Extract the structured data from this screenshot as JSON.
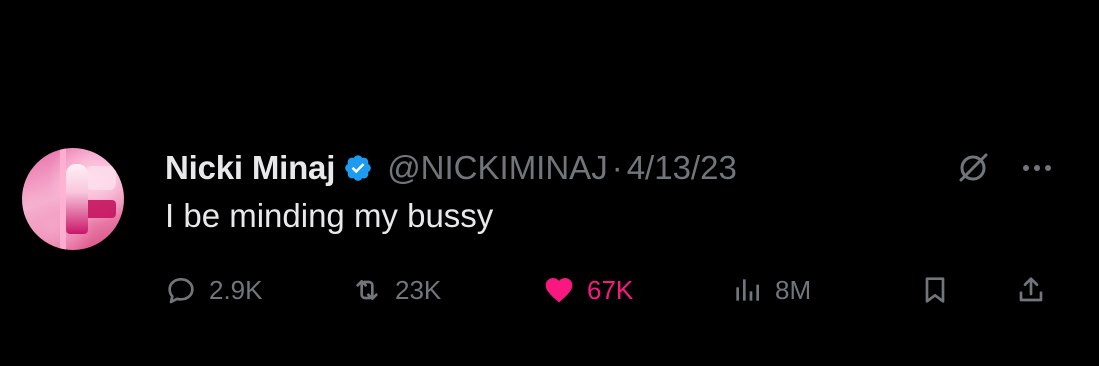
{
  "tweet": {
    "author_name": "Nicki Minaj",
    "handle": "@NICKIMINAJ",
    "separator": "·",
    "date": "4/13/23",
    "text": "I be minding my bussy",
    "verified": true,
    "accent_color": "#1d9bf0",
    "like_color": "#f91880"
  },
  "actions": {
    "replies": "2.9K",
    "reposts": "23K",
    "likes": "67K",
    "views": "8M"
  },
  "icons": [
    "verified-badge-icon",
    "grok-icon",
    "more-icon",
    "reply-icon",
    "repost-icon",
    "like-heart-icon",
    "views-icon",
    "bookmark-icon",
    "share-icon"
  ]
}
